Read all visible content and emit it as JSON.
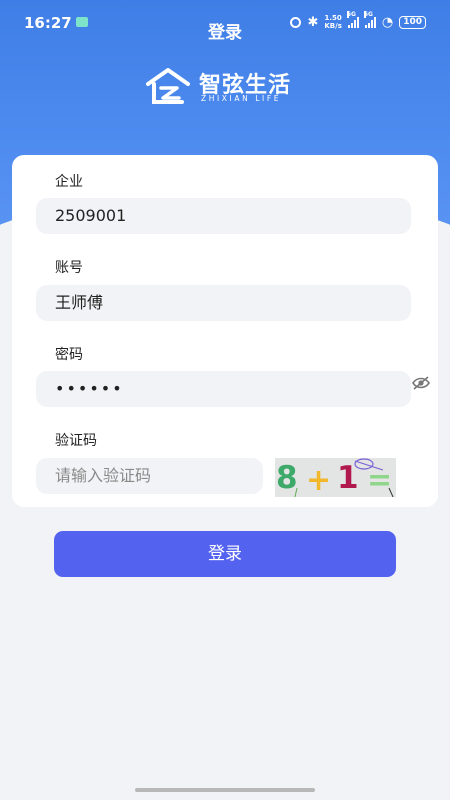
{
  "status_bar": {
    "time": "16:27",
    "speed_value": "1.50",
    "speed_unit": "KB/s",
    "signal1_tag": "5G",
    "signal2_tag": "5G",
    "battery": "100"
  },
  "header": {
    "title": "登录",
    "logo_text": "智弦生活",
    "logo_subtext": "ZHIXIAN LIFE"
  },
  "form": {
    "company_label": "企业",
    "company_value": "2509001",
    "account_label": "账号",
    "account_value": "王师傅",
    "password_label": "密码",
    "password_value": "••••••",
    "captcha_label": "验证码",
    "captcha_placeholder": "请输入验证码",
    "captcha_text": {
      "digit1": "8",
      "op": "+",
      "digit2": "1",
      "eq": "="
    }
  },
  "login_button_label": "登录",
  "colors": {
    "header_blue": "#3f7ee6",
    "button_blue": "#5462f0",
    "input_bg": "#f2f3f6"
  }
}
